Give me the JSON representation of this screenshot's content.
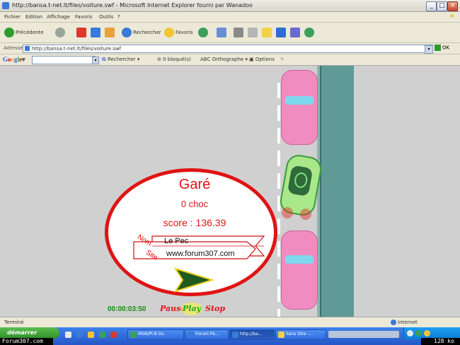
{
  "window": {
    "title": "http://bansa.t-net.lt/files/voiture.swf - Microsoft Internet Explorer fourni par Wanadoo"
  },
  "menu": {
    "items": [
      "Fichier",
      "Edition",
      "Affichage",
      "Favoris",
      "Outils",
      "?"
    ]
  },
  "toolbar": {
    "back_label": "Précédente",
    "search_label": "Rechercher",
    "favorites_label": "Favoris"
  },
  "address": {
    "label": "Adresse",
    "url": "http://bansa.t-net.lt/files/voiture.swf",
    "go_label": "OK"
  },
  "google_bar": {
    "logo": "Google",
    "search_label": "Rechercher",
    "pagerank_label": "0 bloqué(s)",
    "spell_label": "Orthographe",
    "options_label": "Options"
  },
  "game": {
    "status": "Garé",
    "collisions": "0 choc",
    "score": "score : 136.39",
    "nom_label": "Nom",
    "site_label": "Site",
    "name_value": "Le Pec",
    "site_value": "www.forum307.com",
    "timer": "00:00:03:50",
    "pause_label": "Pause",
    "play_label": "Play",
    "stop_label": "Stop"
  },
  "status_bar": {
    "left": "Terminé",
    "zone": "Internet"
  },
  "taskbar": {
    "start_label": "démarrer",
    "buttons": [
      {
        "label": "MSN/Pl.8 Ou"
      },
      {
        "label": "Forum Pe..."
      },
      {
        "label": "http://ba..."
      },
      {
        "label": "Sans titre -..."
      }
    ]
  },
  "watermark": {
    "left": "Forum307.com",
    "right": "128 ko"
  },
  "colors": {
    "ellipse_border": "#e01414",
    "timer": "#1a8a1a",
    "pause": "#e01414",
    "play": "#23a623",
    "stop": "#e01414",
    "sidewalk": "#5f9a96",
    "parked_car": "#f08cc0",
    "player_car": "#a8e88a"
  }
}
